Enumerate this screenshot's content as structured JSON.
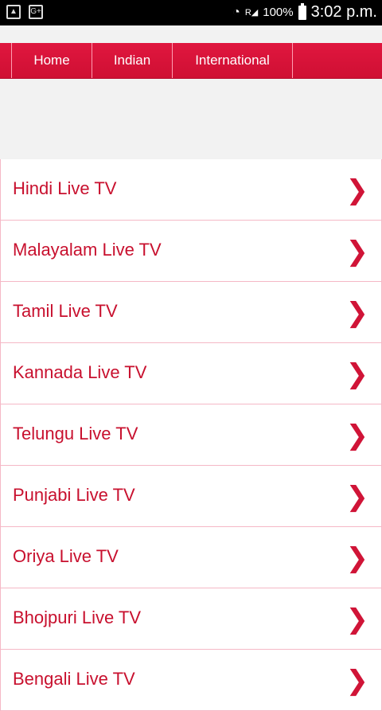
{
  "statusbar": {
    "battery": "100%",
    "time": "3:02 p.m.",
    "signal_letter": "R"
  },
  "nav": {
    "items": [
      {
        "label": "Home"
      },
      {
        "label": "Indian"
      },
      {
        "label": "International"
      }
    ]
  },
  "list": {
    "items": [
      {
        "label": "Hindi Live TV"
      },
      {
        "label": "Malayalam Live TV"
      },
      {
        "label": "Tamil Live TV"
      },
      {
        "label": "Kannada Live TV"
      },
      {
        "label": "Telungu Live TV"
      },
      {
        "label": "Punjabi Live TV"
      },
      {
        "label": "Oriya Live TV"
      },
      {
        "label": "Bhojpuri Live TV"
      },
      {
        "label": "Bengali Live TV"
      }
    ],
    "chevron_icon": "chevron-right-icon"
  },
  "colors": {
    "accent": "#d01437",
    "nav_bg": "#e0173f",
    "row_border": "#f5b8c6"
  }
}
